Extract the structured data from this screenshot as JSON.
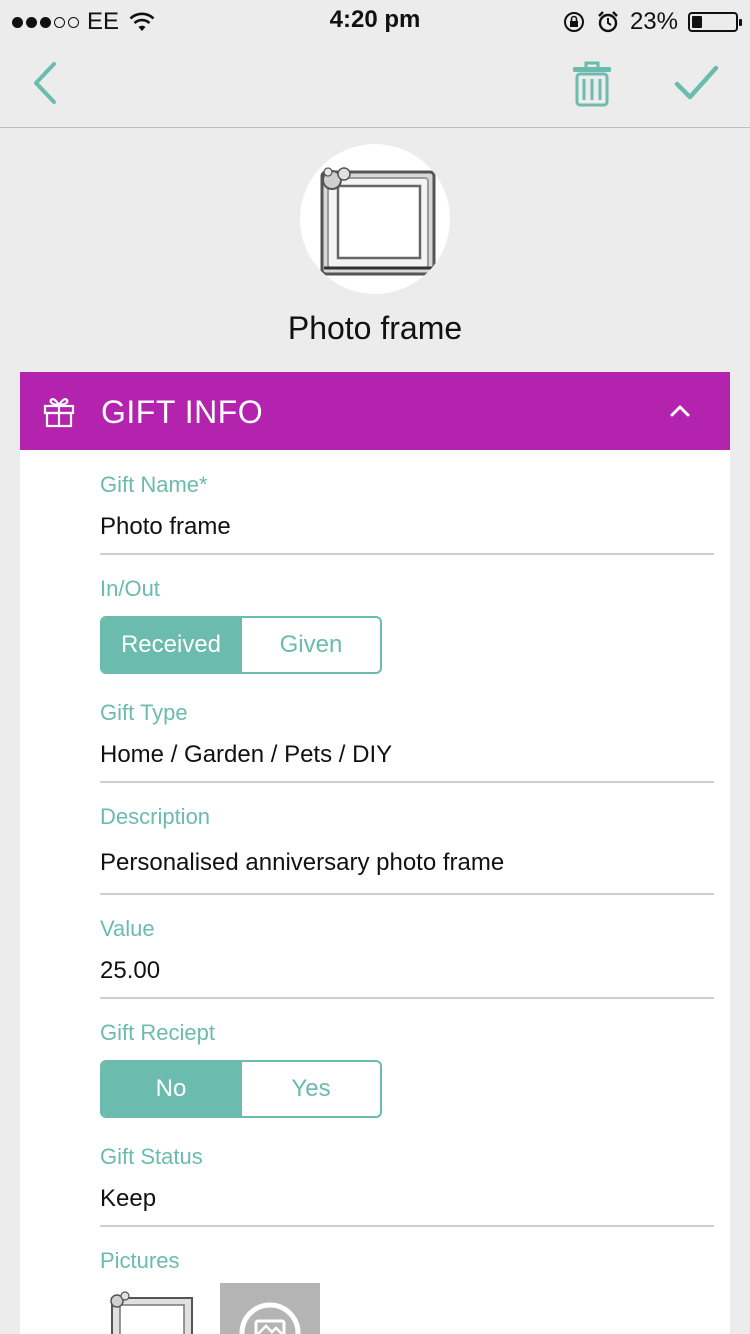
{
  "status_bar": {
    "carrier": "EE",
    "time": "4:20 pm",
    "battery_percent": "23%",
    "battery_level": 0.23,
    "signal_bars_filled": 3,
    "signal_bars_total": 5
  },
  "nav": {
    "back_icon": "chevron-left-icon",
    "delete_icon": "trash-icon",
    "save_icon": "checkmark-icon"
  },
  "gift": {
    "title": "Photo frame"
  },
  "section": {
    "title": "GIFT INFO",
    "icon": "gift-icon",
    "toggle_icon": "chevron-up-icon",
    "color": "#b423ad"
  },
  "fields": {
    "gift_name": {
      "label": "Gift Name*",
      "value": "Photo frame"
    },
    "in_out": {
      "label": "In/Out",
      "options": [
        "Received",
        "Given"
      ],
      "selected": "Received"
    },
    "gift_type": {
      "label": "Gift Type",
      "value": "Home / Garden / Pets / DIY"
    },
    "description": {
      "label": "Description",
      "value": "Personalised anniversary photo frame"
    },
    "value": {
      "label": "Value",
      "value": "25.00"
    },
    "gift_receipt": {
      "label": "Gift Reciept",
      "options": [
        "No",
        "Yes"
      ],
      "selected": "No"
    },
    "gift_status": {
      "label": "Gift Status",
      "value": "Keep"
    },
    "pictures": {
      "label": "Pictures"
    }
  },
  "colors": {
    "accent": "#6bbbae",
    "section_header": "#b423ad",
    "background": "#ececec"
  }
}
